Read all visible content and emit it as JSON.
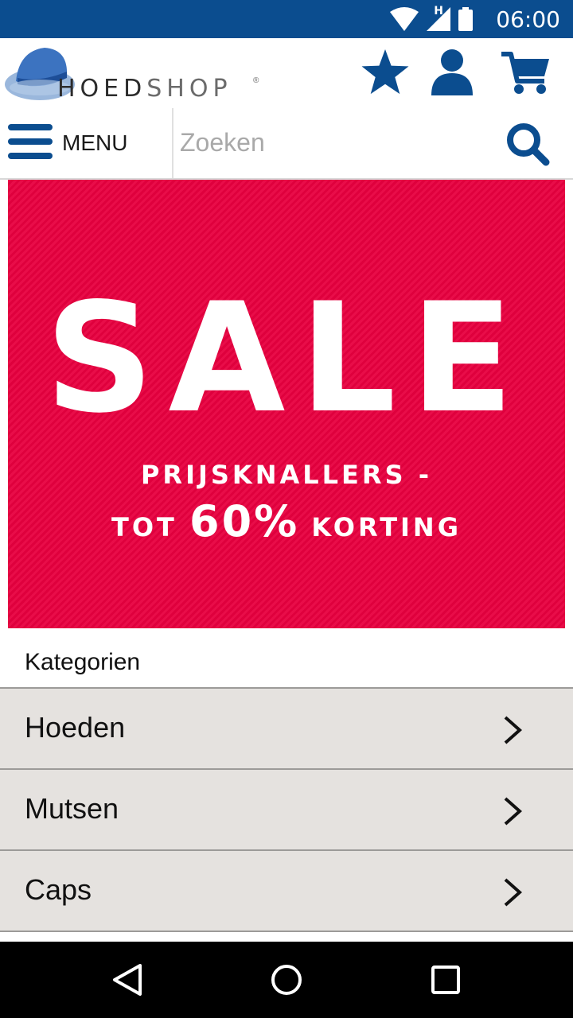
{
  "status_bar": {
    "time": "06:00",
    "network_letter": "H",
    "icons": [
      "wifi-icon",
      "cell-signal-icon",
      "battery-icon"
    ]
  },
  "header": {
    "logo_text_strong": "HOED",
    "logo_text_light": "SHOP",
    "logo_reg": "®",
    "icons": [
      "favorites-star-icon",
      "account-user-icon",
      "shopping-cart-icon"
    ]
  },
  "search": {
    "menu_label": "MENU",
    "placeholder": "Zoeken",
    "value": ""
  },
  "banner": {
    "headline": "SALE",
    "line1": "PRIJSKNALLERS -",
    "line2_prefix": "TOT",
    "line2_highlight": "60%",
    "line2_suffix": "KORTING",
    "background_color": "#e8003f"
  },
  "categories": {
    "title": "Kategorien",
    "items": [
      {
        "label": "Hoeden"
      },
      {
        "label": "Mutsen"
      },
      {
        "label": "Caps"
      }
    ]
  },
  "colors": {
    "brand_blue": "#0b4d8f",
    "row_bg": "#e5e2df"
  },
  "nav_bar": {
    "icons": [
      "back-icon",
      "home-icon",
      "recents-icon"
    ]
  }
}
